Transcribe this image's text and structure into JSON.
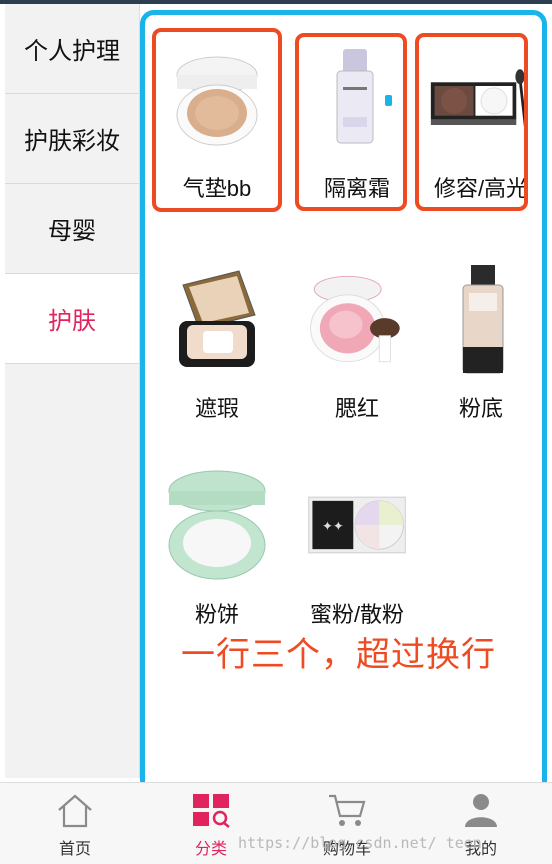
{
  "sidebar": {
    "items": [
      {
        "label": "个人护理",
        "active": false
      },
      {
        "label": "护肤彩妆",
        "active": false
      },
      {
        "label": "母婴",
        "active": false
      },
      {
        "label": "护肤",
        "active": true
      }
    ]
  },
  "products": [
    {
      "label": "气垫bb",
      "icon": "cushion-compact-icon",
      "highlighted": true
    },
    {
      "label": "隔离霜",
      "icon": "primer-bottle-icon",
      "highlighted": true
    },
    {
      "label": "修容/高光",
      "icon": "contour-palette-icon",
      "highlighted": true
    },
    {
      "label": "遮瑕",
      "icon": "concealer-compact-icon",
      "highlighted": false
    },
    {
      "label": "腮红",
      "icon": "blush-compact-icon",
      "highlighted": false
    },
    {
      "label": "粉底",
      "icon": "foundation-bottle-icon",
      "highlighted": false
    },
    {
      "label": "粉饼",
      "icon": "pressed-powder-icon",
      "highlighted": false
    },
    {
      "label": "蜜粉/散粉",
      "icon": "loose-powder-icon",
      "highlighted": false
    }
  ],
  "annotation": "一行三个，超过换行",
  "tabbar": {
    "tabs": [
      {
        "label": "首页",
        "icon": "home-icon",
        "active": false
      },
      {
        "label": "分类",
        "icon": "category-icon",
        "active": true
      },
      {
        "label": "购物车",
        "icon": "cart-icon",
        "active": false
      },
      {
        "label": "我的",
        "icon": "user-icon",
        "active": false
      }
    ]
  },
  "watermark": "https://blog.csdn.net/        teen",
  "colors": {
    "accent_pink": "#e0245e",
    "frame_blue": "#1ab3ea",
    "highlight_red": "#ef4b22"
  }
}
